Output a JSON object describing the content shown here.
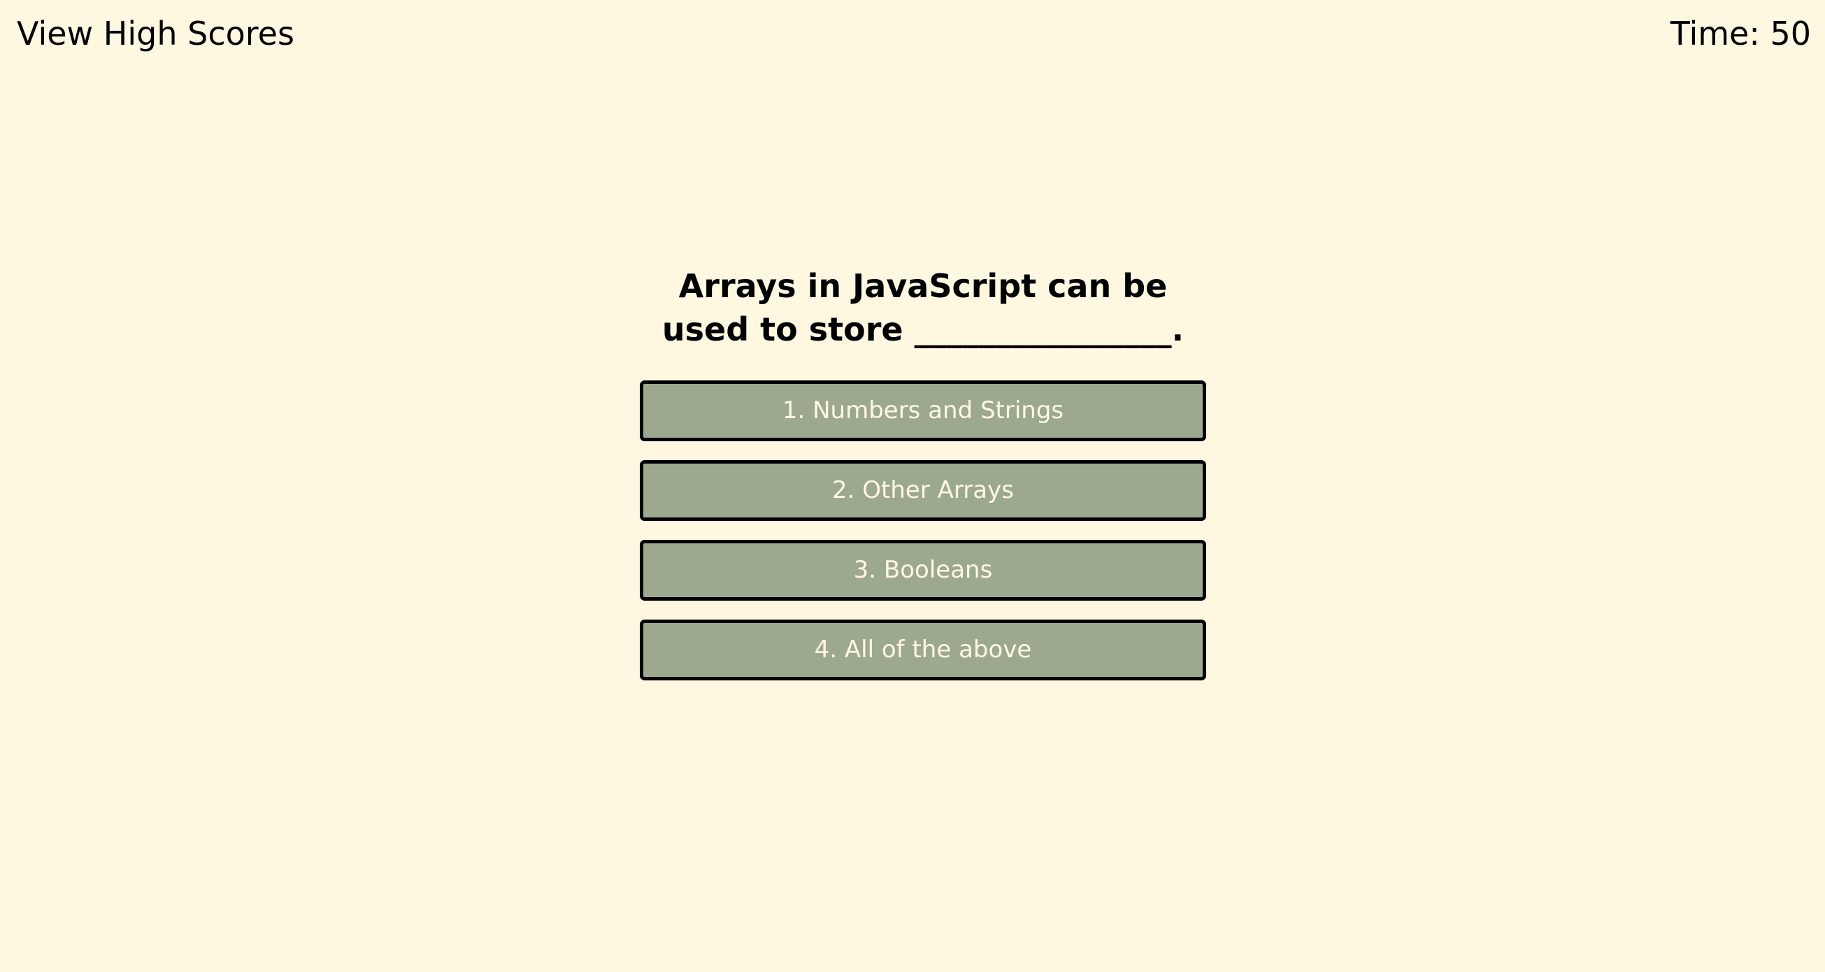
{
  "header": {
    "high_scores_label": "View High Scores",
    "timer_label": "Time: 50"
  },
  "quiz": {
    "question": "Arrays in JavaScript can be used to store ________________.",
    "answers": [
      {
        "label": "1. Numbers and Strings"
      },
      {
        "label": "2. Other Arrays"
      },
      {
        "label": "3. Booleans"
      },
      {
        "label": "4. All of the above"
      }
    ]
  },
  "colors": {
    "background": "#fff8e1",
    "button_fill": "#9ca98f",
    "button_border": "#000000",
    "button_text": "#fff8e1"
  }
}
